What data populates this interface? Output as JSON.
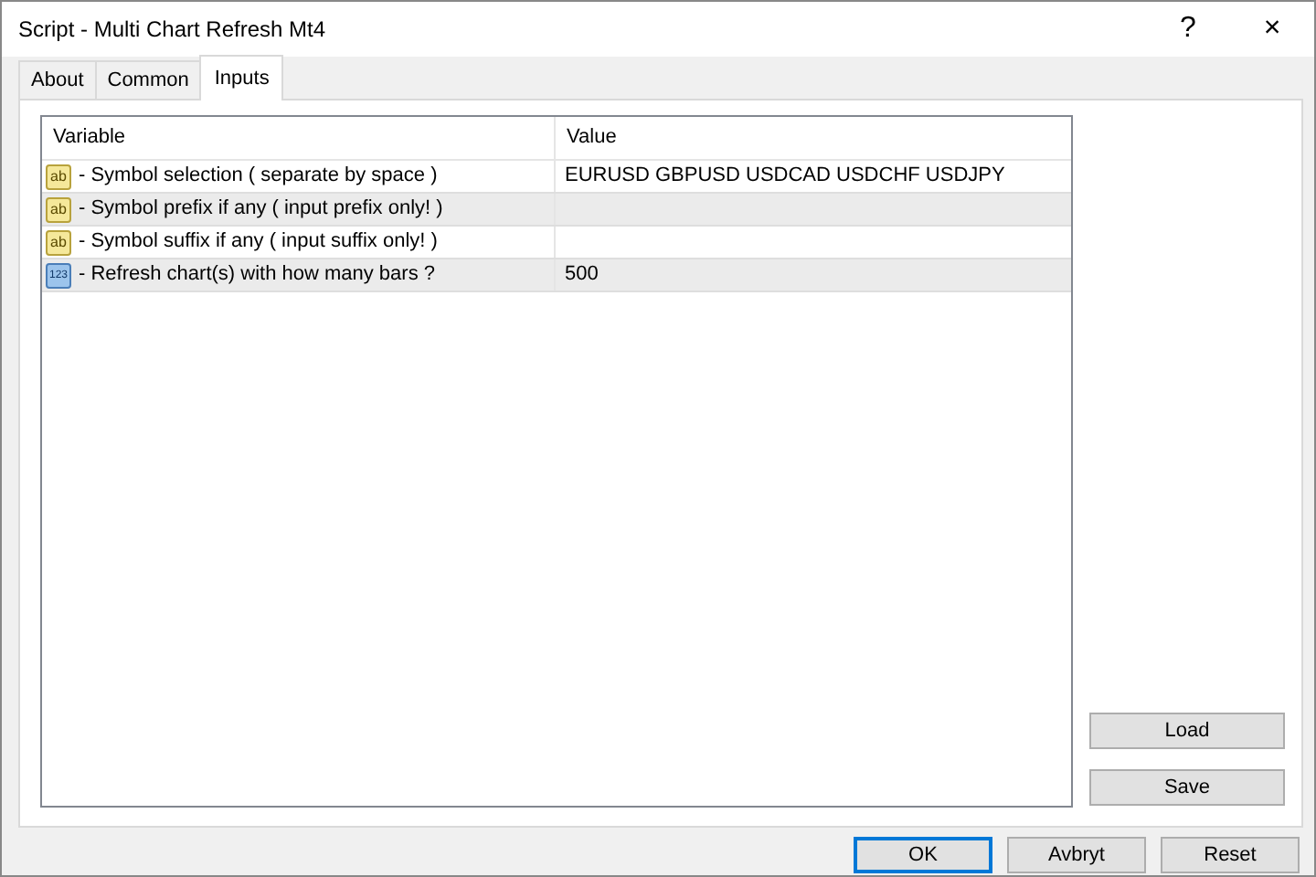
{
  "window": {
    "title": "Script - Multi Chart Refresh Mt4",
    "help": "?",
    "close": "×"
  },
  "tabs": [
    {
      "label": "About",
      "selected": false
    },
    {
      "label": "Common",
      "selected": false
    },
    {
      "label": "Inputs",
      "selected": true
    }
  ],
  "table": {
    "columns": [
      "Variable",
      "Value"
    ],
    "rows": [
      {
        "type_icon": "ab",
        "kind": "string",
        "variable": "- Symbol selection ( separate by space )",
        "value": "EURUSD GBPUSD USDCAD USDCHF USDJPY"
      },
      {
        "type_icon": "ab",
        "kind": "string",
        "variable": "- Symbol prefix if any ( input prefix only! )",
        "value": ""
      },
      {
        "type_icon": "ab",
        "kind": "string",
        "variable": "- Symbol suffix if any ( input suffix only! )",
        "value": ""
      },
      {
        "type_icon": "123",
        "kind": "int",
        "variable": "- Refresh chart(s) with how many bars ?",
        "value": "500"
      }
    ]
  },
  "side_buttons": [
    "Load",
    "Save"
  ],
  "buttons": [
    {
      "label": "OK",
      "default": true
    },
    {
      "label": "Avbryt",
      "default": false
    },
    {
      "label": "Reset",
      "default": false
    }
  ]
}
